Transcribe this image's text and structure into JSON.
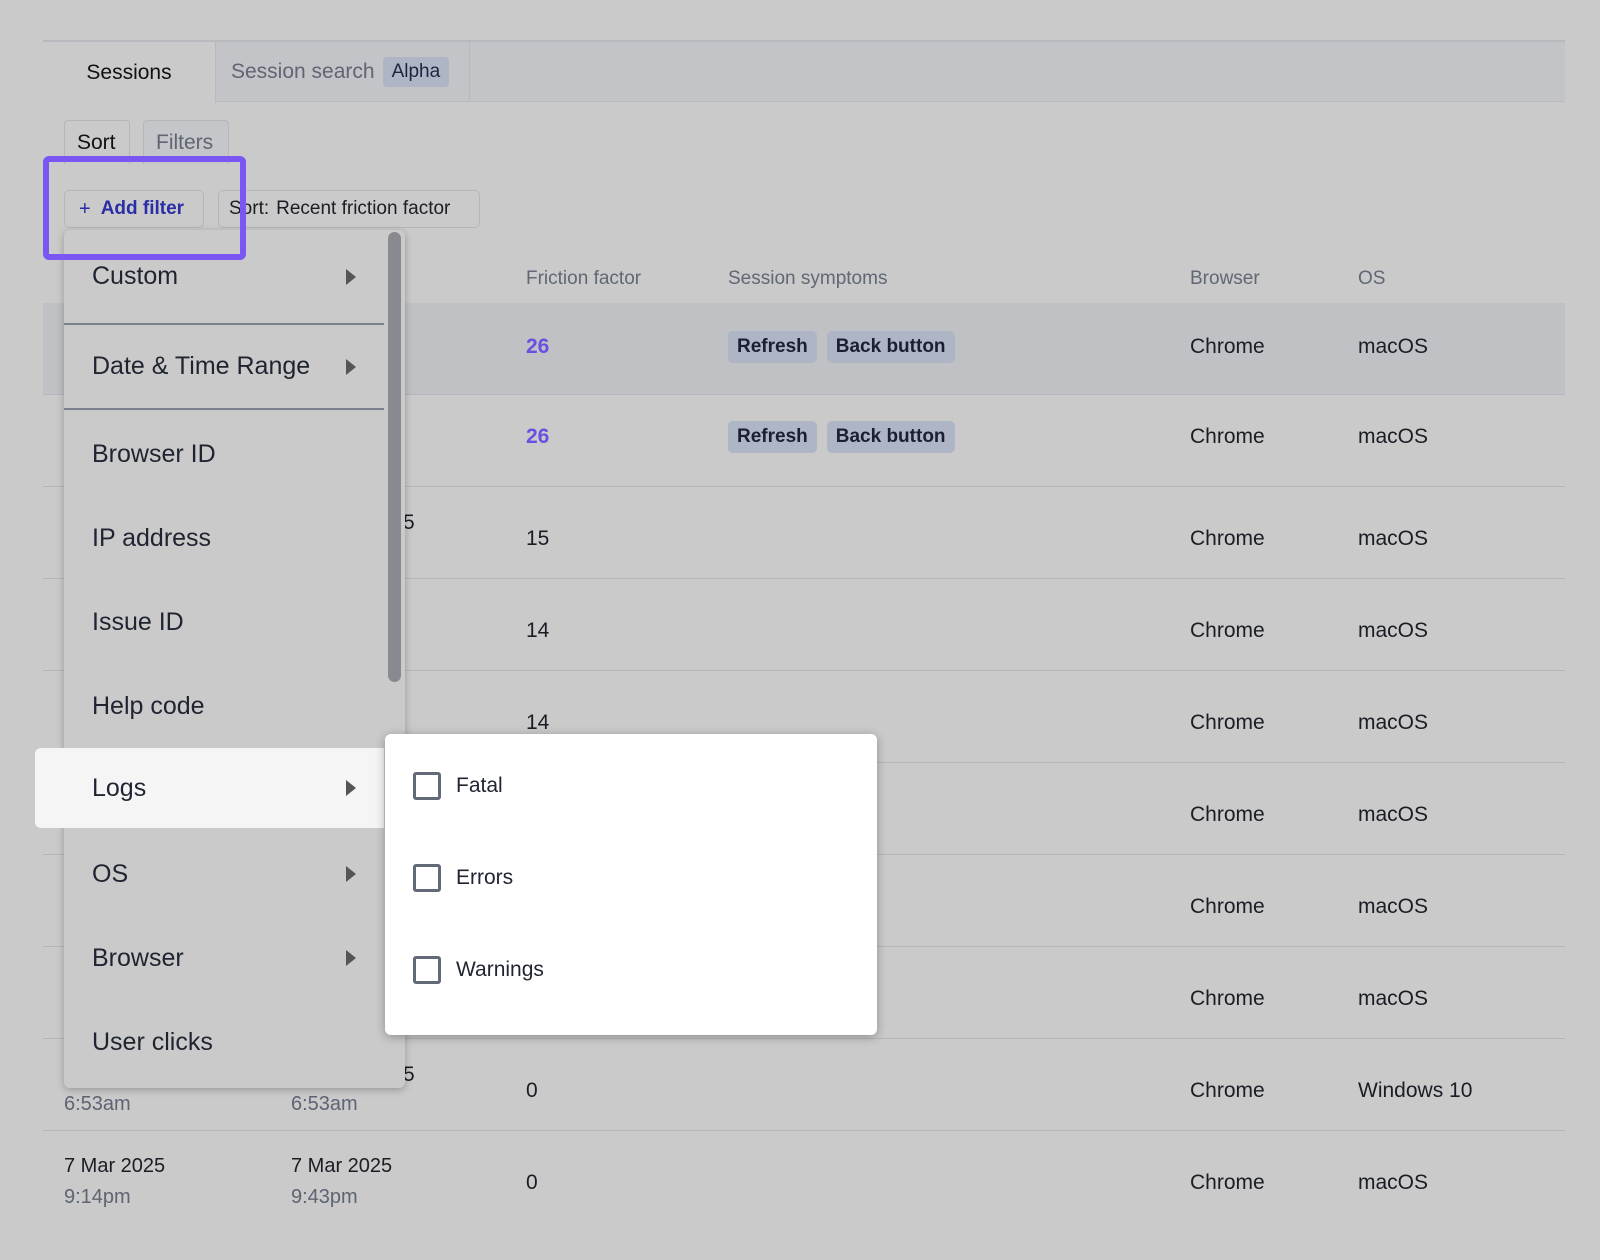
{
  "tabs": [
    {
      "label": "Sessions"
    },
    {
      "label": "Session search",
      "badge": "Alpha"
    }
  ],
  "toolbar": {
    "sort_label": "Sort",
    "filters_label": "Filters",
    "add_filter_icon": "plus-icon",
    "add_filter_label": "+",
    "add_filter_text": "Add filter",
    "sort_chip_key": "Sort:",
    "sort_chip_value": "Recent friction factor"
  },
  "table": {
    "headers": [
      "Friction factor",
      "Session symptoms",
      "Browser",
      "OS"
    ],
    "rows": [
      {
        "friction": "26",
        "symptoms": [
          "Refresh",
          "Back button"
        ],
        "browser": "Chrome",
        "os": "macOS"
      },
      {
        "friction": "26",
        "symptoms": [
          "Refresh",
          "Back button"
        ],
        "browser": "Chrome",
        "os": "macOS"
      },
      {
        "friction": "15",
        "frag": "5",
        "browser": "Chrome",
        "os": "macOS"
      },
      {
        "friction": "14",
        "browser": "Chrome",
        "os": "macOS"
      },
      {
        "friction": "14",
        "browser": "Chrome",
        "os": "macOS"
      },
      {
        "browser": "Chrome",
        "os": "macOS"
      },
      {
        "browser": "Chrome",
        "os": "macOS"
      },
      {
        "browser": "Chrome",
        "os": "macOS"
      },
      {
        "friction": "0",
        "frag": "5",
        "start_time": "6:53am",
        "end_time": "6:53am",
        "browser": "Chrome",
        "os": "Windows 10"
      },
      {
        "friction": "0",
        "start_date": "7 Mar 2025",
        "start_time": "9:14pm",
        "end_date": "7 Mar 2025",
        "end_time": "9:43pm",
        "browser": "Chrome",
        "os": "macOS"
      }
    ]
  },
  "menu": {
    "items": [
      {
        "label": "Custom",
        "has_arrow": true
      },
      {
        "label": "Date & Time Range",
        "has_arrow": true
      },
      {
        "label": "Browser ID"
      },
      {
        "label": "IP address"
      },
      {
        "label": "Issue ID"
      },
      {
        "label": "Help code"
      },
      {
        "label": "Logs",
        "has_arrow": true
      },
      {
        "label": "OS",
        "has_arrow": true
      },
      {
        "label": "Browser",
        "has_arrow": true
      },
      {
        "label": "User clicks"
      }
    ]
  },
  "submenu": {
    "options": [
      {
        "label": "Fatal"
      },
      {
        "label": "Errors"
      },
      {
        "label": "Warnings"
      }
    ]
  },
  "colors": {
    "highlight": "#7a57f2",
    "link": "#6a4fe0",
    "accent_text": "#2a2fa8"
  }
}
